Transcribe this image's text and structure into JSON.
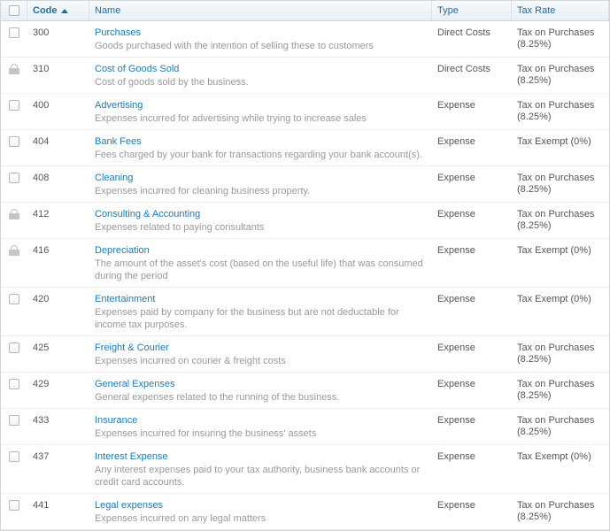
{
  "header": {
    "code": "Code",
    "name": "Name",
    "type": "Type",
    "tax": "Tax Rate"
  },
  "rows": [
    {
      "locked": false,
      "code": "300",
      "name": "Purchases",
      "desc": "Goods purchased with the intention of selling these to customers",
      "type": "Direct Costs",
      "tax": "Tax on Purchases (8.25%)"
    },
    {
      "locked": true,
      "code": "310",
      "name": "Cost of Goods Sold",
      "desc": "Cost of goods sold by the business.",
      "type": "Direct Costs",
      "tax": "Tax on Purchases (8.25%)"
    },
    {
      "locked": false,
      "code": "400",
      "name": "Advertising",
      "desc": "Expenses incurred for advertising while trying to increase sales",
      "type": "Expense",
      "tax": "Tax on Purchases (8.25%)"
    },
    {
      "locked": false,
      "code": "404",
      "name": "Bank Fees",
      "desc": "Fees charged by your bank for transactions regarding your bank account(s).",
      "type": "Expense",
      "tax": "Tax Exempt (0%)"
    },
    {
      "locked": false,
      "code": "408",
      "name": "Cleaning",
      "desc": "Expenses incurred for cleaning business property.",
      "type": "Expense",
      "tax": "Tax on Purchases (8.25%)"
    },
    {
      "locked": true,
      "code": "412",
      "name": "Consulting & Accounting",
      "desc": "Expenses related to paying consultants",
      "type": "Expense",
      "tax": "Tax on Purchases (8.25%)"
    },
    {
      "locked": true,
      "code": "416",
      "name": "Depreciation",
      "desc": "The amount of the asset's cost (based on the useful life) that was consumed during the period",
      "type": "Expense",
      "tax": "Tax Exempt (0%)"
    },
    {
      "locked": false,
      "code": "420",
      "name": "Entertainment",
      "desc": "Expenses paid by company for the business but are not deductable for income tax purposes.",
      "type": "Expense",
      "tax": "Tax Exempt (0%)"
    },
    {
      "locked": false,
      "code": "425",
      "name": "Freight & Courier",
      "desc": "Expenses incurred on courier & freight costs",
      "type": "Expense",
      "tax": "Tax on Purchases (8.25%)"
    },
    {
      "locked": false,
      "code": "429",
      "name": "General Expenses",
      "desc": "General expenses related to the running of the business.",
      "type": "Expense",
      "tax": "Tax on Purchases (8.25%)"
    },
    {
      "locked": false,
      "code": "433",
      "name": "Insurance",
      "desc": "Expenses incurred for insuring the business' assets",
      "type": "Expense",
      "tax": "Tax on Purchases (8.25%)"
    },
    {
      "locked": false,
      "code": "437",
      "name": "Interest Expense",
      "desc": "Any interest expenses paid to your tax authority, business bank accounts or credit card accounts.",
      "type": "Expense",
      "tax": "Tax Exempt (0%)"
    },
    {
      "locked": false,
      "code": "441",
      "name": "Legal expenses",
      "desc": "Expenses incurred on any legal matters",
      "type": "Expense",
      "tax": "Tax on Purchases (8.25%)"
    }
  ]
}
